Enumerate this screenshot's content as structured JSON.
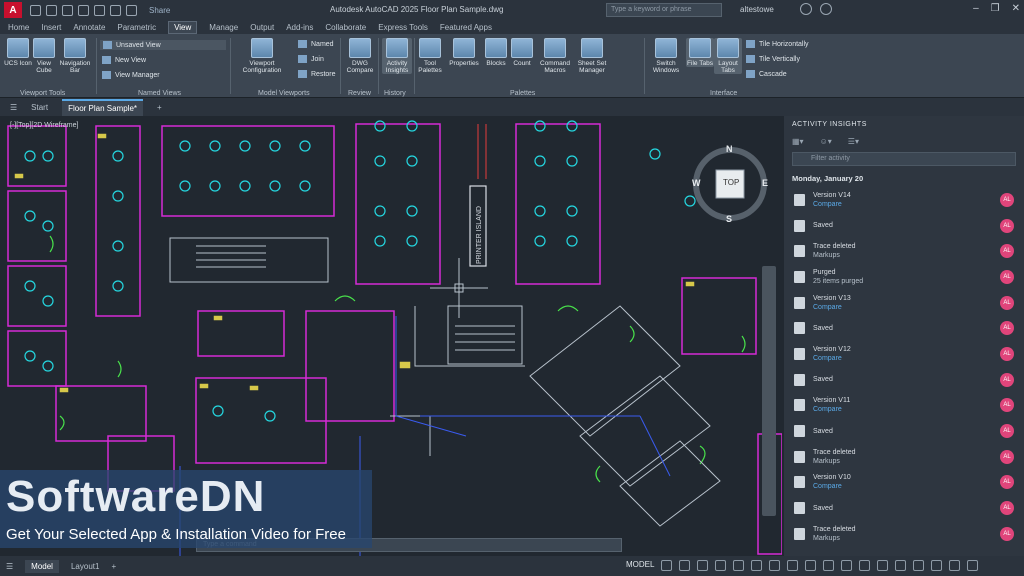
{
  "titlebar": {
    "logo": "A",
    "share": "Share",
    "title": "Autodesk AutoCAD 2025   Floor Plan Sample.dwg",
    "search_placeholder": "Type a keyword or phrase",
    "user": "altestowe"
  },
  "ribbon_tabs": [
    "Home",
    "Insert",
    "Annotate",
    "Parametric",
    "View",
    "Manage",
    "Output",
    "Add-ins",
    "Collaborate",
    "Express Tools",
    "Featured Apps"
  ],
  "ribbon_active": "View",
  "ribbon": {
    "viewport_tools": {
      "buttons": [
        "UCS Icon",
        "View Cube",
        "Navigation Bar"
      ],
      "title": "Viewport Tools"
    },
    "named_views": {
      "items": [
        "Unsaved View",
        "New View",
        "View Manager"
      ],
      "title": "Named Views"
    },
    "model_viewports": {
      "buttons": [
        "Viewport Configuration"
      ],
      "items": [
        "Named",
        "Join",
        "Restore"
      ],
      "title": "Model Viewports"
    },
    "review": {
      "buttons": [
        "DWG Compare"
      ],
      "title": "Review"
    },
    "history": {
      "buttons": [
        "Activity Insights"
      ],
      "title": "History"
    },
    "palettes": {
      "buttons": [
        "Tool Palettes",
        "Properties",
        "Blocks",
        "Count",
        "Command Macros",
        "Sheet Set Manager"
      ],
      "title": "Palettes"
    },
    "interface": {
      "buttons": [
        "Switch Windows",
        "File Tabs",
        "Layout Tabs"
      ],
      "items": [
        "Tile Horizontally",
        "Tile Vertically",
        "Cascade"
      ],
      "title": "Interface"
    }
  },
  "doctabs": {
    "start": "Start",
    "active": "Floor Plan Sample*",
    "add": "+"
  },
  "canvas": {
    "viewport_label": "[-][Top][2D Wireframe]",
    "room_label": "PRINTER ISLAND",
    "compass": {
      "N": "N",
      "S": "S",
      "E": "E",
      "W": "W",
      "center": "TOP"
    }
  },
  "activity": {
    "title": "ACTIVITY INSIGHTS",
    "search_placeholder": "Filter activity",
    "day": "Monday, January 20",
    "entries": [
      {
        "title": "Version V14",
        "sub": "Compare",
        "avatar": "AL"
      },
      {
        "title": "Saved",
        "sub": "",
        "avatar": "AL"
      },
      {
        "title": "Trace deleted",
        "sub": "Markups",
        "avatar": "AL"
      },
      {
        "title": "Purged",
        "sub": "25 items purged",
        "avatar": "AL"
      },
      {
        "title": "Version V13",
        "sub": "Compare",
        "avatar": "AL"
      },
      {
        "title": "Saved",
        "sub": "",
        "avatar": "AL"
      },
      {
        "title": "Version V12",
        "sub": "Compare",
        "avatar": "AL"
      },
      {
        "title": "Saved",
        "sub": "",
        "avatar": "AL"
      },
      {
        "title": "Version V11",
        "sub": "Compare",
        "avatar": "AL"
      },
      {
        "title": "Saved",
        "sub": "",
        "avatar": "AL"
      },
      {
        "title": "Trace deleted",
        "sub": "Markups",
        "avatar": "AL"
      },
      {
        "title": "Version V10",
        "sub": "Compare",
        "avatar": "AL"
      },
      {
        "title": "Saved",
        "sub": "",
        "avatar": "AL"
      },
      {
        "title": "Trace deleted",
        "sub": "Markups",
        "avatar": "AL"
      }
    ]
  },
  "command_placeholder": "Type a command",
  "statusbar": {
    "model": "Model",
    "layout": "Layout1",
    "add": "+",
    "mode": "MODEL"
  },
  "watermark": {
    "title": "SoftwareDN",
    "subtitle": "Get Your Selected App & Installation Video for Free"
  },
  "colors": {
    "magenta": "#d62bd6",
    "cyan": "#25d7e0",
    "green": "#49e34b",
    "blue": "#3a5bf0",
    "yellow": "#e8d44a",
    "red": "#e23b3b"
  }
}
